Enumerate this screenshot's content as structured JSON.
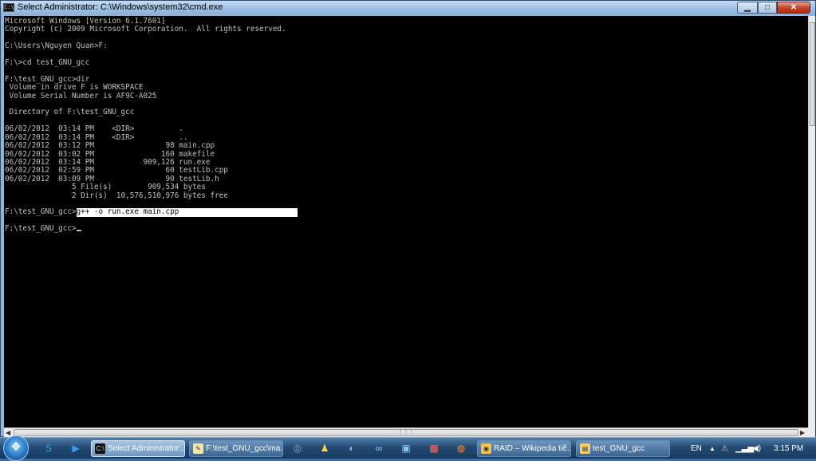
{
  "window": {
    "title": "Select Administrator: C:\\Windows\\system32\\cmd.exe",
    "icon_text": "C:\\",
    "buttons": {
      "minimize": "▁",
      "maximize": "□",
      "close": "✕"
    }
  },
  "console": {
    "lines": [
      "Microsoft Windows [Version 6.1.7601]",
      "Copyright (c) 2009 Microsoft Corporation.  All rights reserved.",
      "",
      "C:\\Users\\Nguyen Quan>F:",
      "",
      "F:\\>cd test_GNU_gcc",
      "",
      "F:\\test_GNU_gcc>dir",
      " Volume in drive F is WORKSPACE",
      " Volume Serial Number is AF9C-A025",
      "",
      " Directory of F:\\test_GNU_gcc",
      "",
      "06/02/2012  03:14 PM    <DIR>          .",
      "06/02/2012  03:14 PM    <DIR>          ..",
      "06/02/2012  03:12 PM                98 main.cpp",
      "06/02/2012  03:02 PM               160 makefile",
      "06/02/2012  03:14 PM           909,126 run.exe",
      "06/02/2012  02:59 PM                60 testLib.cpp",
      "06/02/2012  03:09 PM                90 testLib.h",
      "               5 File(s)        909,534 bytes",
      "               2 Dir(s)  10,576,510,976 bytes free",
      ""
    ],
    "selected_prompt": "F:\\test_GNU_gcc>",
    "selected_text": "g++ -o run.exe main.cpp",
    "final_prompt": "F:\\test_GNU_gcc>"
  },
  "taskbar": {
    "start_label": "❖",
    "tasks": [
      {
        "label": "Select Administrator:...",
        "icon": "C:\\",
        "icon_color": "#111111",
        "active": true
      },
      {
        "label": "F:\\test_GNU_gcc\\ma...",
        "icon": "✎",
        "icon_color": "#f3e6a8",
        "active": false
      },
      {
        "label": "RAID – Wikipedia tiế...",
        "icon": "◉",
        "icon_color": "#f2c14e",
        "active": false
      },
      {
        "label": "test_GNU_gcc",
        "icon": "▤",
        "icon_color": "#f2d06b",
        "active": false
      }
    ],
    "tray": {
      "language": "EN",
      "time": "3:15 PM"
    }
  }
}
